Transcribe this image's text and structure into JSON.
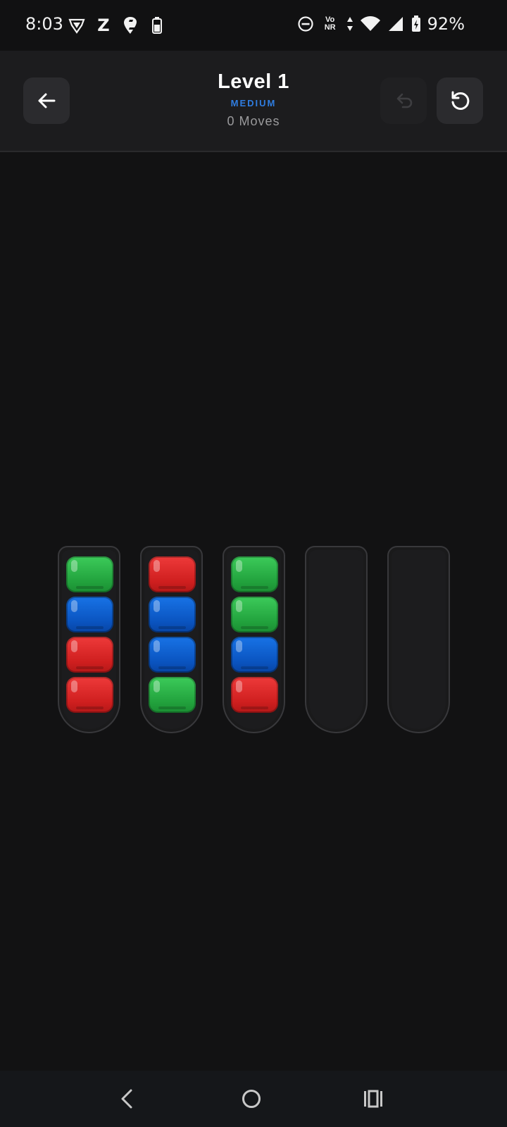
{
  "status_bar": {
    "time": "8:03",
    "left_icons": [
      "vpn-shield-icon",
      "z-app-icon",
      "swiggy-icon",
      "battery-saver-icon"
    ],
    "z_label": "Z",
    "right_icons": [
      "do-not-disturb-icon",
      "vo-nr-icon",
      "data-arrows-icon",
      "wifi-icon",
      "cell-signal-icon",
      "battery-charging-icon"
    ],
    "vonr_top": "Vo",
    "vonr_bottom": "NR",
    "battery_percent": "92%"
  },
  "header": {
    "title": "Level 1",
    "difficulty": "MEDIUM",
    "moves": "0 Moves",
    "back_icon": "arrow-left-icon",
    "undo_icon": "undo-icon",
    "restart_icon": "restart-icon",
    "undo_enabled": false
  },
  "colors": {
    "green": "#22a23d",
    "blue": "#0a54c0",
    "red": "#cf1f1f",
    "accent": "#2f7de1",
    "background": "#121213"
  },
  "tubes": [
    {
      "balls": [
        "green",
        "blue",
        "red",
        "red"
      ]
    },
    {
      "balls": [
        "red",
        "blue",
        "blue",
        "green"
      ]
    },
    {
      "balls": [
        "green",
        "green",
        "blue",
        "red"
      ]
    },
    {
      "balls": []
    },
    {
      "balls": []
    }
  ],
  "nav_bar": {
    "icons": [
      "nav-back-icon",
      "nav-home-icon",
      "nav-recents-icon"
    ]
  }
}
